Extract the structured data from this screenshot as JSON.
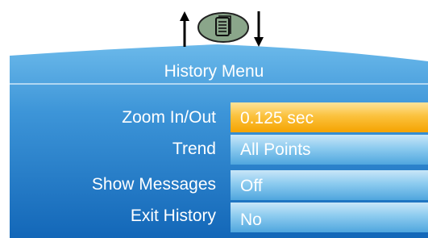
{
  "menu": {
    "title": "History Menu"
  },
  "nav": {
    "up_icon": "arrow-up-icon",
    "history_icon": "history-page-icon",
    "down_icon": "arrow-down-icon"
  },
  "rows": [
    {
      "label": "Zoom In/Out",
      "value": "0.125 sec",
      "selected": true
    },
    {
      "label": "Trend",
      "value": "All Points",
      "selected": false
    },
    {
      "label": "Show Messages",
      "value": "Off",
      "selected": false
    },
    {
      "label": "Exit History",
      "value": "No",
      "selected": false
    }
  ],
  "colors": {
    "panel_top": "#5fb3e8",
    "panel_bottom": "#1a73c2",
    "selected_value": "#f8b520",
    "value_field": "#7cc3ee",
    "key_green": "#8aa68a"
  }
}
